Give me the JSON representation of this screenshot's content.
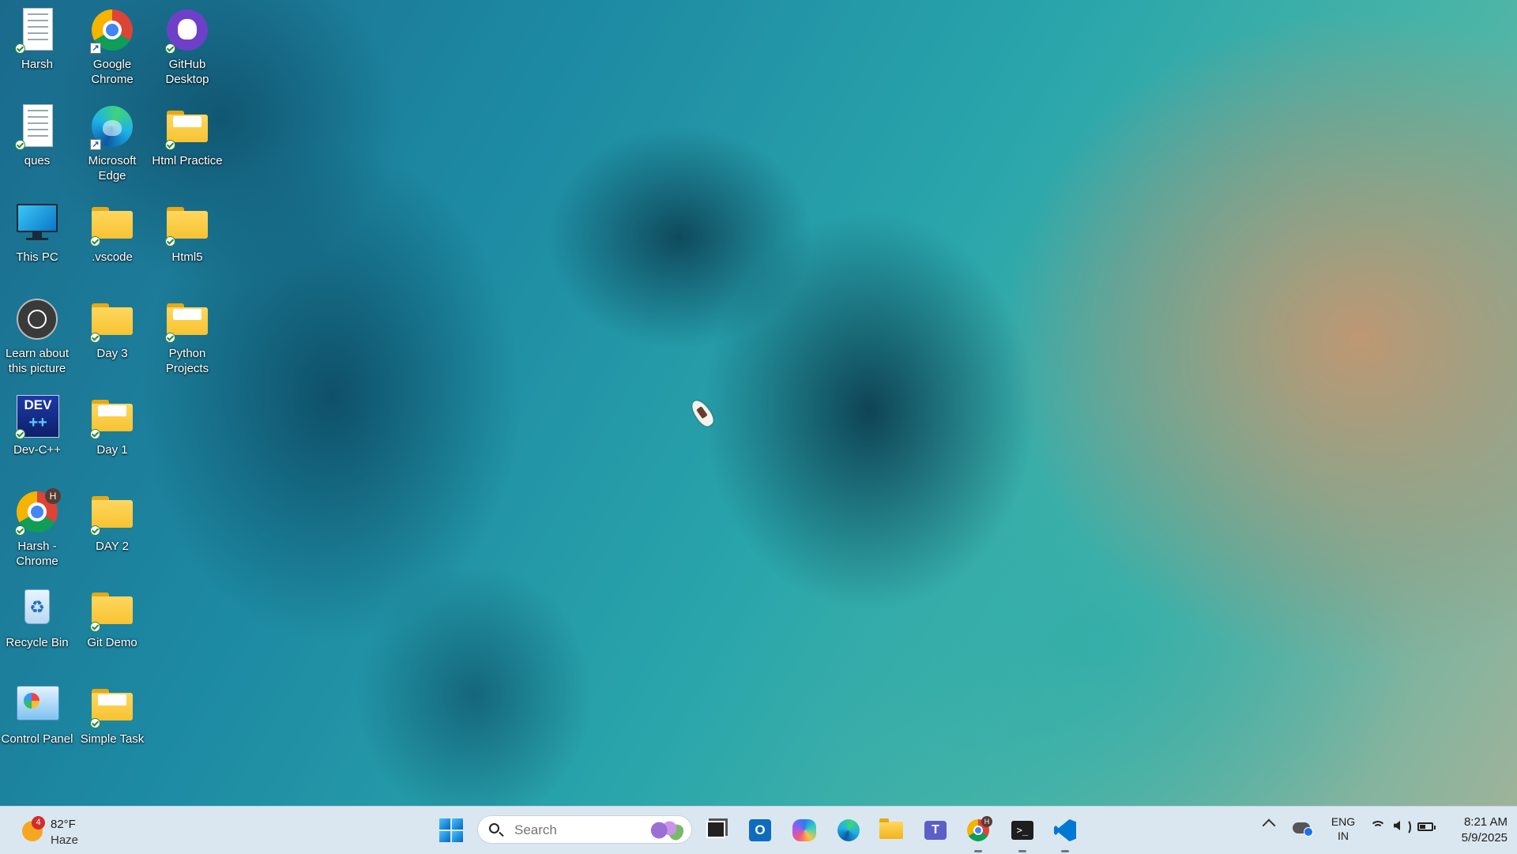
{
  "desktop": {
    "icons": [
      {
        "label": "Harsh",
        "icon": "document-icon"
      },
      {
        "label": "Google Chrome",
        "icon": "chrome-icon"
      },
      {
        "label": "GitHub Desktop",
        "icon": "github-icon"
      },
      {
        "label": "ques",
        "icon": "document-icon"
      },
      {
        "label": "Microsoft Edge",
        "icon": "edge-icon"
      },
      {
        "label": "Html Practice",
        "icon": "folder-icon"
      },
      {
        "label": "This PC",
        "icon": "monitor-icon"
      },
      {
        "label": ".vscode",
        "icon": "folder-icon"
      },
      {
        "label": "Html5",
        "icon": "folder-icon"
      },
      {
        "label": "Learn about this picture",
        "icon": "camera-icon"
      },
      {
        "label": "Day  3",
        "icon": "folder-icon"
      },
      {
        "label": "Python Projects",
        "icon": "folder-icon"
      },
      {
        "label": "Dev-C++",
        "icon": "devcpp-icon"
      },
      {
        "label": "Day 1",
        "icon": "folder-icon"
      },
      {
        "label": "Harsh - Chrome",
        "icon": "chrome-profile-icon",
        "badge": "H"
      },
      {
        "label": "DAY 2",
        "icon": "folder-icon"
      },
      {
        "label": "Recycle Bin",
        "icon": "recycle-bin-icon"
      },
      {
        "label": "Git Demo",
        "icon": "folder-icon"
      },
      {
        "label": "Control Panel",
        "icon": "control-panel-icon"
      },
      {
        "label": "Simple Task",
        "icon": "folder-icon"
      }
    ],
    "devcpp_text": "DEV",
    "devcpp_sub": "++"
  },
  "taskbar": {
    "weather": {
      "temp": "82°F",
      "condition": "Haze",
      "badge": "4"
    },
    "search": {
      "placeholder": "Search"
    },
    "apps": [
      {
        "name": "task-view-icon"
      },
      {
        "name": "outlook-icon",
        "glyph": "O"
      },
      {
        "name": "copilot-icon"
      },
      {
        "name": "edge-icon"
      },
      {
        "name": "file-explorer-icon"
      },
      {
        "name": "teams-icon",
        "glyph": "T"
      },
      {
        "name": "chrome-icon",
        "badge": "H"
      },
      {
        "name": "terminal-icon",
        "glyph": ">_"
      },
      {
        "name": "vscode-icon"
      }
    ],
    "tray": {
      "language": "ENG",
      "region": "IN",
      "time": "8:21 AM",
      "date": "5/9/2025"
    }
  }
}
